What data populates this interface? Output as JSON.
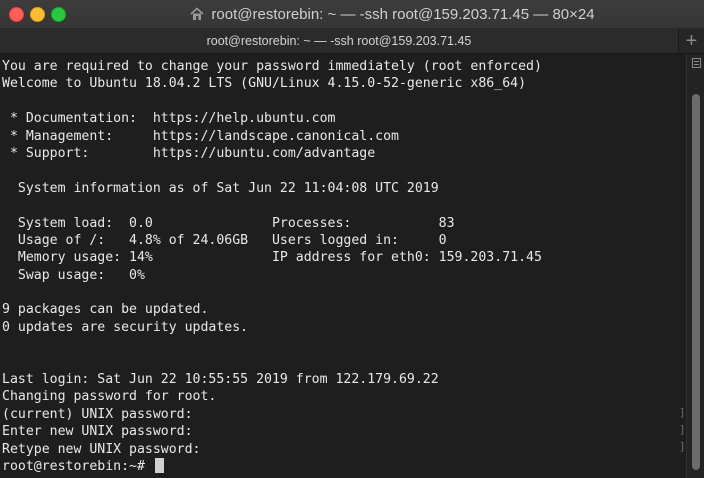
{
  "window": {
    "title": "root@restorebin: ~ — -ssh root@159.203.71.45 — 80×24",
    "title_icon": "house-icon",
    "traffic_lights": {
      "close": "#ff5f57",
      "minimize": "#febc2e",
      "zoom": "#28c840"
    }
  },
  "tabbar": {
    "tab_title": "root@restorebin: ~ — -ssh root@159.203.71.45",
    "new_tab_label": "+"
  },
  "terminal": {
    "lines": [
      "You are required to change your password immediately (root enforced)",
      "Welcome to Ubuntu 18.04.2 LTS (GNU/Linux 4.15.0-52-generic x86_64)",
      "",
      " * Documentation:  https://help.ubuntu.com",
      " * Management:     https://landscape.canonical.com",
      " * Support:        https://ubuntu.com/advantage",
      "",
      "  System information as of Sat Jun 22 11:04:08 UTC 2019",
      "",
      "  System load:  0.0               Processes:           83",
      "  Usage of /:   4.8% of 24.06GB   Users logged in:     0",
      "  Memory usage: 14%               IP address for eth0: 159.203.71.45",
      "  Swap usage:   0%",
      "",
      "9 packages can be updated.",
      "0 updates are security updates.",
      "",
      "",
      "Last login: Sat Jun 22 10:55:55 2019 from 122.179.69.22",
      "Changing password for root.",
      "(current) UNIX password:",
      "Enter new UNIX password:",
      "Retype new UNIX password:"
    ],
    "prompt": "root@restorebin:~# ",
    "edge_mark": "]",
    "colors": {
      "background": "#1e1e1e",
      "foreground": "#e8e8e8",
      "cursor": "#d0d0d0"
    }
  },
  "scrollbar": {
    "icon": "scroll-menu-icon"
  }
}
